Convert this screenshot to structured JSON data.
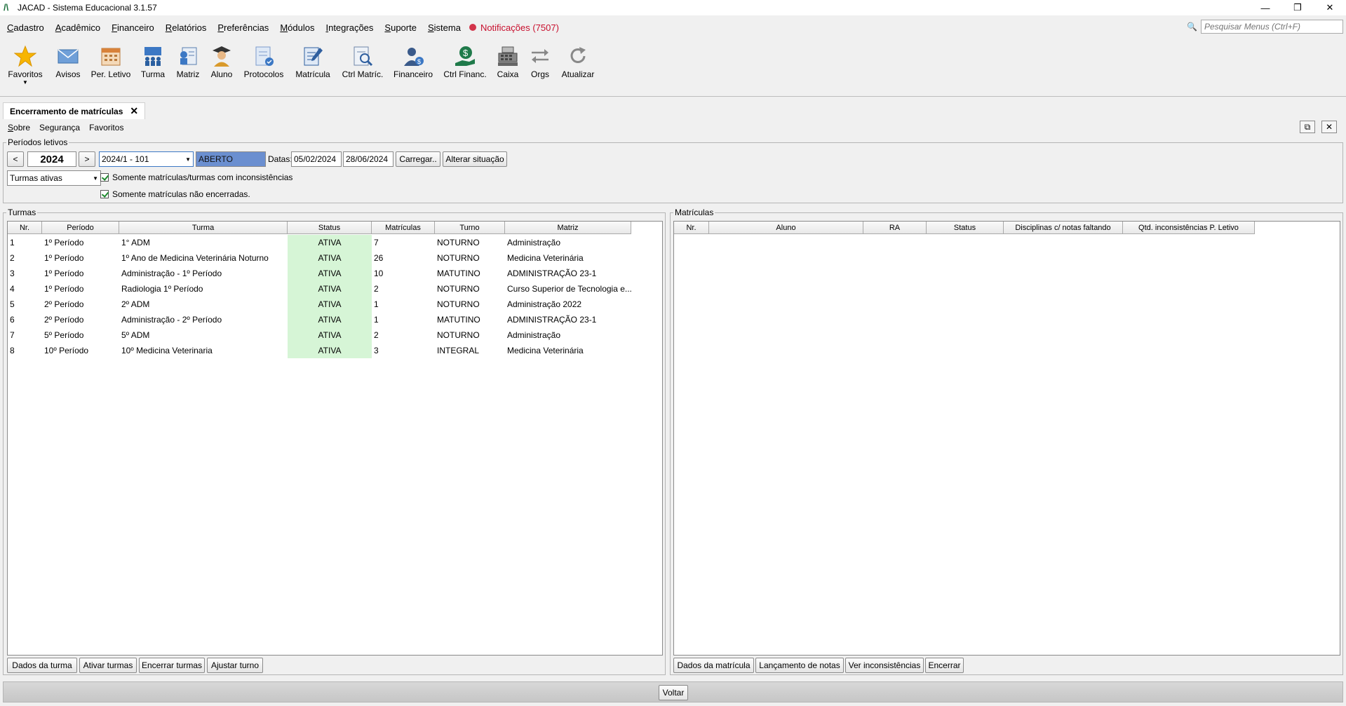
{
  "window": {
    "title": "JACAD - Sistema Educacional 3.1.57",
    "logo": "/\\",
    "controls": [
      "—",
      "❐",
      "✕"
    ]
  },
  "menu": {
    "items": [
      "Cadastro",
      "Acadêmico",
      "Financeiro",
      "Relatórios",
      "Preferências",
      "Módulos",
      "Integrações",
      "Suporte",
      "Sistema"
    ],
    "notifications": "Notificações (7507)",
    "search_placeholder": "Pesquisar Menus (Ctrl+F)"
  },
  "toolbar": {
    "items": [
      {
        "label": "Favoritos",
        "icon": "star-icon"
      },
      {
        "label": "Avisos",
        "icon": "envelope-icon"
      },
      {
        "label": "Per. Letivo",
        "icon": "calendar-icon"
      },
      {
        "label": "Turma",
        "icon": "group-icon"
      },
      {
        "label": "Matriz",
        "icon": "matrix-icon"
      },
      {
        "label": "Aluno",
        "icon": "student-icon"
      },
      {
        "label": "Protocolos",
        "icon": "document-icon"
      },
      {
        "label": "Matrícula",
        "icon": "edit-document-icon"
      },
      {
        "label": "Ctrl Matríc.",
        "icon": "search-document-icon"
      },
      {
        "label": "Financeiro",
        "icon": "finance-user-icon"
      },
      {
        "label": "Ctrl Financ.",
        "icon": "money-hand-icon"
      },
      {
        "label": "Caixa",
        "icon": "cash-register-icon"
      },
      {
        "label": "Orgs",
        "icon": "arrows-icon"
      },
      {
        "label": "Atualizar",
        "icon": "refresh-icon"
      }
    ]
  },
  "tab": {
    "title": "Encerramento de matrículas",
    "close": "✕",
    "submenu": [
      "Sobre",
      "Segurança",
      "Favoritos"
    ]
  },
  "periodos": {
    "label": "Períodos letivos",
    "prev": "<",
    "year": "2024",
    "next": ">",
    "periodo_select": "2024/1 - 101",
    "situacao": "ABERTO",
    "datas_label": "Datas:",
    "data_inicio": "05/02/2024",
    "data_fim": "28/06/2024",
    "carregar": "Carregar..",
    "alterar": "Alterar situação",
    "turmas_filter": "Turmas ativas",
    "chk1": "Somente matrículas/turmas com inconsistências",
    "chk2": "Somente matrículas não encerradas."
  },
  "turmas": {
    "label": "Turmas",
    "columns": [
      "Nr.",
      "Período",
      "Turma",
      "Status",
      "Matrículas",
      "Turno",
      "Matriz"
    ],
    "rows": [
      [
        "1",
        "1º Período",
        "1° ADM",
        "ATIVA",
        "7",
        "NOTURNO",
        "Administração"
      ],
      [
        "2",
        "1º Período",
        "1º Ano de Medicina Veterinária Noturno",
        "ATIVA",
        "26",
        "NOTURNO",
        "Medicina Veterinária"
      ],
      [
        "3",
        "1º Período",
        "Administração - 1º Período",
        "ATIVA",
        "10",
        "MATUTINO",
        "ADMINISTRAÇÃO 23-1"
      ],
      [
        "4",
        "1º Período",
        "Radiologia 1º Período",
        "ATIVA",
        "2",
        "NOTURNO",
        "Curso Superior de Tecnologia e..."
      ],
      [
        "5",
        "2º Período",
        "2º ADM",
        "ATIVA",
        "1",
        "NOTURNO",
        "Administração 2022"
      ],
      [
        "6",
        "2º Período",
        "Administração - 2º Período",
        "ATIVA",
        "1",
        "MATUTINO",
        "ADMINISTRAÇÃO 23-1"
      ],
      [
        "7",
        "5º Período",
        "5º ADM",
        "ATIVA",
        "2",
        "NOTURNO",
        "Administração"
      ],
      [
        "8",
        "10º Período",
        "10º  Medicina Veterinaria",
        "ATIVA",
        "3",
        "INTEGRAL",
        "Medicina Veterinária"
      ]
    ],
    "buttons": [
      "Dados da turma",
      "Ativar turmas",
      "Encerrar turmas",
      "Ajustar turno"
    ]
  },
  "matriculas": {
    "label": "Matrículas",
    "columns": [
      "Nr.",
      "Aluno",
      "RA",
      "Status",
      "Disciplinas c/ notas faltando",
      "Qtd. inconsistências P. Letivo"
    ],
    "buttons": [
      "Dados da matrícula",
      "Lançamento de notas",
      "Ver inconsistências",
      "Encerrar"
    ]
  },
  "footer": {
    "voltar": "Voltar"
  }
}
